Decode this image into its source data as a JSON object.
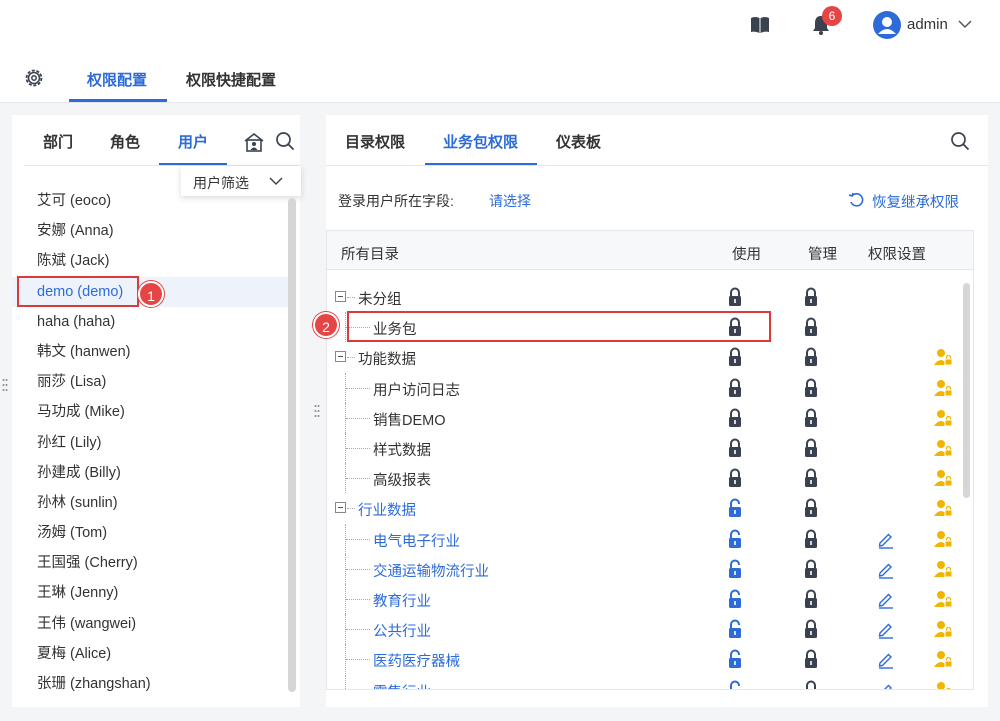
{
  "header": {
    "notification_count": "6",
    "user_name": "admin",
    "icons": [
      "book-icon",
      "bell-icon",
      "user-avatar-icon",
      "chevron-down-icon"
    ]
  },
  "main_tabs": [
    {
      "label": "权限配置",
      "active": true
    },
    {
      "label": "权限快捷配置",
      "active": false
    }
  ],
  "left": {
    "tabs": [
      {
        "label": "部门",
        "active": false
      },
      {
        "label": "角色",
        "active": false
      },
      {
        "label": "用户",
        "active": true
      }
    ],
    "filter_label": "用户筛选",
    "users": [
      "艾可 (eoco)",
      "安娜 (Anna)",
      "陈斌 (Jack)",
      "demo (demo)",
      "haha (haha)",
      "韩文 (hanwen)",
      "丽莎 (Lisa)",
      "马功成 (Mike)",
      "孙红 (Lily)",
      "孙建成 (Billy)",
      "孙林 (sunlin)",
      "汤姆 (Tom)",
      "王国强 (Cherry)",
      "王琳 (Jenny)",
      "王伟 (wangwei)",
      "夏梅 (Alice)",
      "张珊 (zhangshan)"
    ],
    "selected_user": "demo (demo)"
  },
  "callouts": {
    "one": "1",
    "two": "2"
  },
  "right": {
    "tabs": [
      {
        "label": "目录权限",
        "active": false
      },
      {
        "label": "业务包权限",
        "active": true
      },
      {
        "label": "仪表板",
        "active": false
      }
    ],
    "field_label": "登录用户所在字段:",
    "field_select": "请选择",
    "restore_label": "恢复继承权限",
    "columns": {
      "dir": "所有目录",
      "use": "使用",
      "manage": "管理",
      "setting": "权限设置"
    },
    "rows": [
      {
        "name": "未分组",
        "level": 0,
        "group": true,
        "use": "locked",
        "manage": "locked",
        "edit": false,
        "perm": false,
        "link": false
      },
      {
        "name": "业务包",
        "level": 1,
        "group": false,
        "use": "locked",
        "manage": "locked",
        "edit": false,
        "perm": false,
        "link": false
      },
      {
        "name": "功能数据",
        "level": 0,
        "group": true,
        "use": "locked",
        "manage": "locked",
        "edit": false,
        "perm": true,
        "link": false
      },
      {
        "name": "用户访问日志",
        "level": 1,
        "group": false,
        "use": "locked",
        "manage": "locked",
        "edit": false,
        "perm": true,
        "link": false
      },
      {
        "name": "销售DEMO",
        "level": 1,
        "group": false,
        "use": "locked",
        "manage": "locked",
        "edit": false,
        "perm": true,
        "link": false
      },
      {
        "name": "样式数据",
        "level": 1,
        "group": false,
        "use": "locked",
        "manage": "locked",
        "edit": false,
        "perm": true,
        "link": false
      },
      {
        "name": "高级报表",
        "level": 1,
        "group": false,
        "use": "locked",
        "manage": "locked",
        "edit": false,
        "perm": true,
        "link": false
      },
      {
        "name": "行业数据",
        "level": 0,
        "group": true,
        "use": "unlocked",
        "manage": "locked",
        "edit": false,
        "perm": true,
        "link": true
      },
      {
        "name": "电气电子行业",
        "level": 1,
        "group": false,
        "use": "unlocked",
        "manage": "locked",
        "edit": true,
        "perm": true,
        "link": true
      },
      {
        "name": "交通运输物流行业",
        "level": 1,
        "group": false,
        "use": "unlocked",
        "manage": "locked",
        "edit": true,
        "perm": true,
        "link": true
      },
      {
        "name": "教育行业",
        "level": 1,
        "group": false,
        "use": "unlocked",
        "manage": "locked",
        "edit": true,
        "perm": true,
        "link": true
      },
      {
        "name": "公共行业",
        "level": 1,
        "group": false,
        "use": "unlocked",
        "manage": "locked",
        "edit": true,
        "perm": true,
        "link": true
      },
      {
        "name": "医药医疗器械",
        "level": 1,
        "group": false,
        "use": "unlocked",
        "manage": "locked",
        "edit": true,
        "perm": true,
        "link": true
      },
      {
        "name": "零售行业",
        "level": 1,
        "group": false,
        "use": "unlocked",
        "manage": "locked",
        "edit": true,
        "perm": true,
        "link": true
      }
    ]
  },
  "colors": {
    "accent": "#2c6bd8",
    "lock_dark": "#3a4250",
    "lock_open": "#2c6bd8",
    "perm_gold": "#f1b400",
    "callout_red": "#d93a3a"
  }
}
